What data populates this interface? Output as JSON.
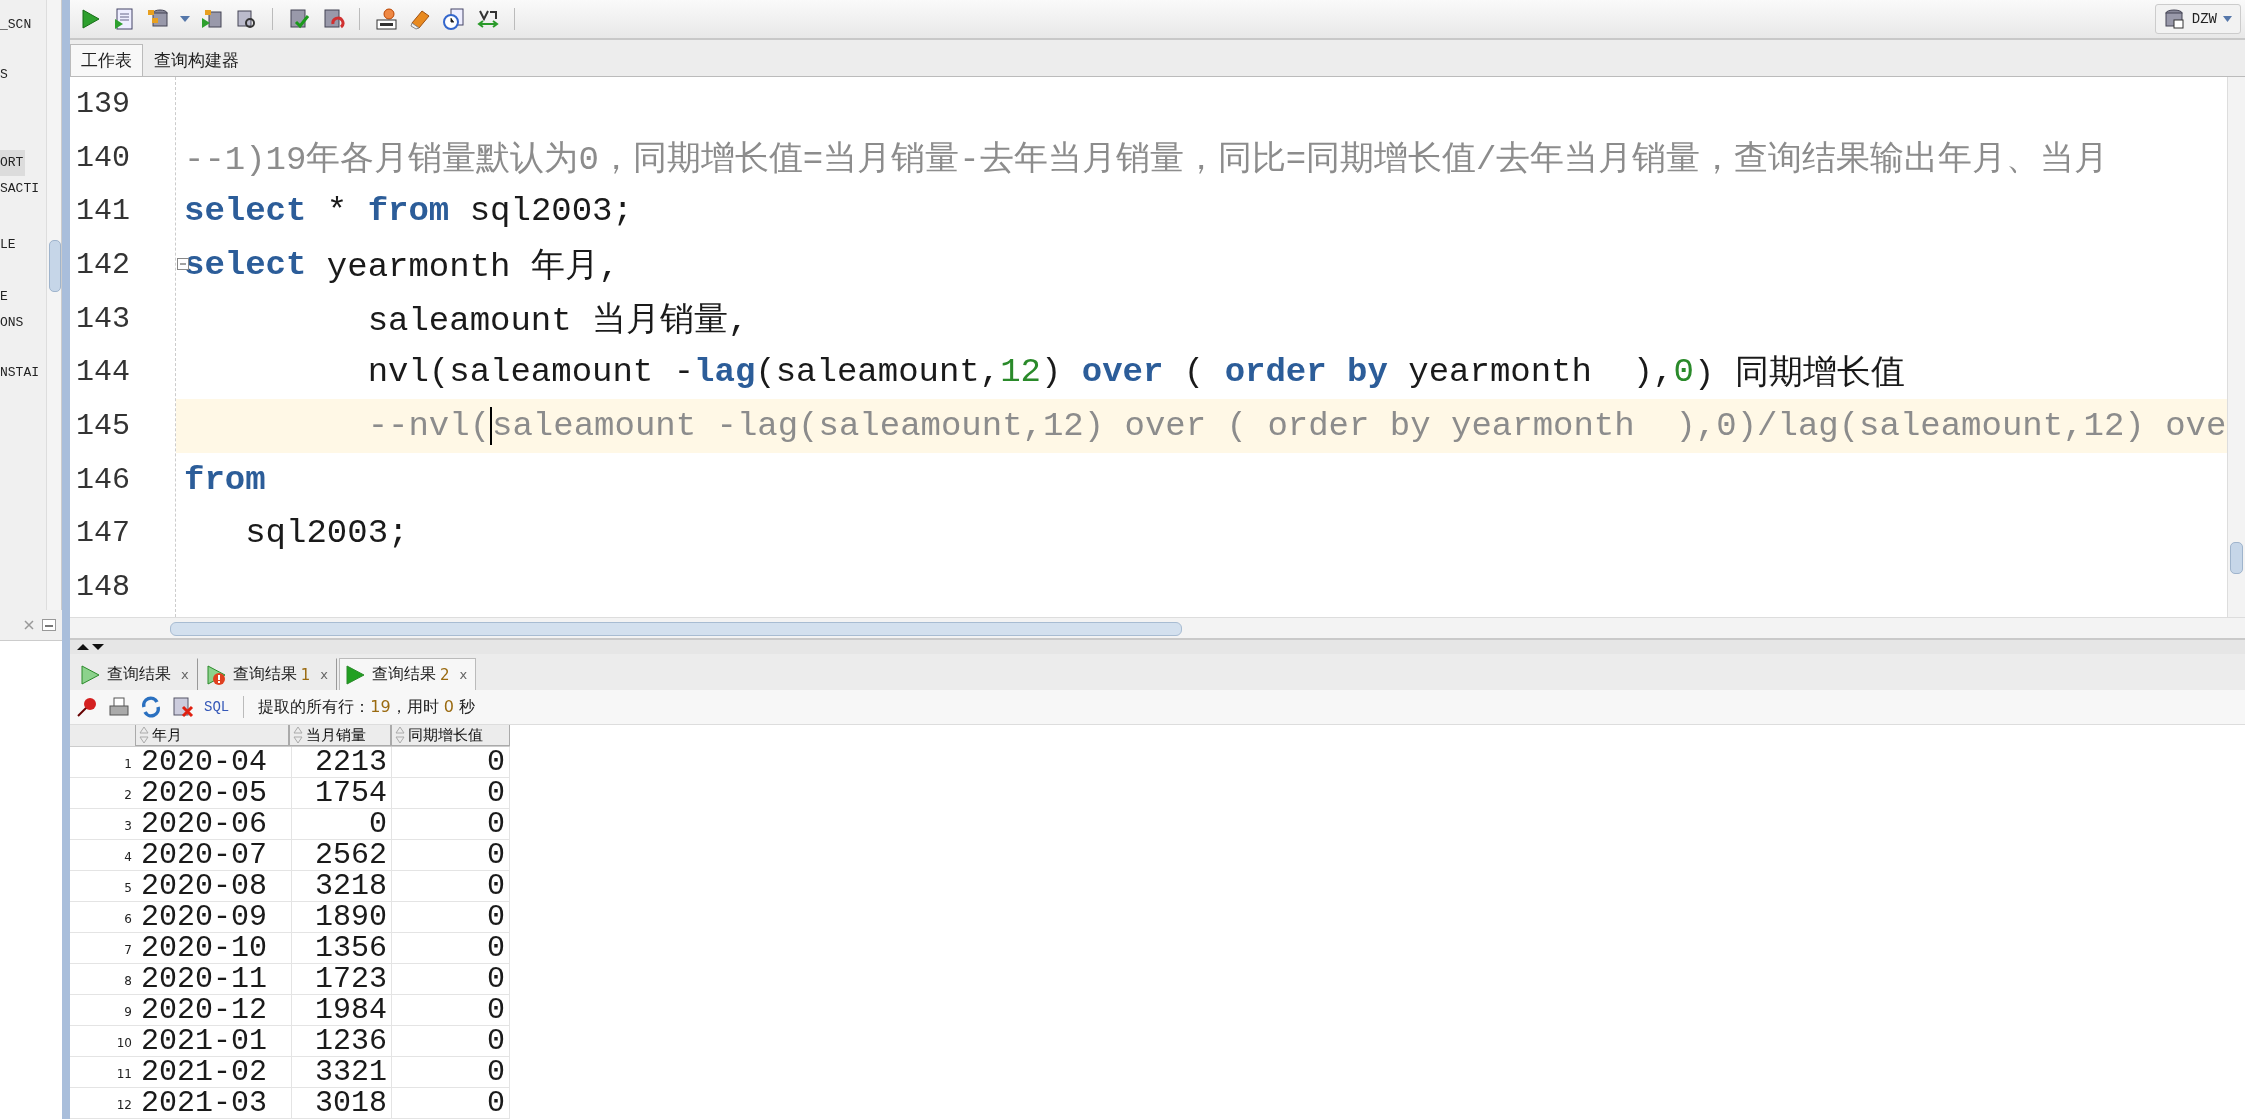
{
  "sidebar": {
    "items": [
      {
        "label": "_SCN",
        "selected": false
      },
      {
        "label": "S",
        "selected": false
      },
      {
        "label": "ORT",
        "selected": true
      },
      {
        "label": "SACTI",
        "selected": false
      },
      {
        "label": "LE",
        "selected": false
      },
      {
        "label": "E",
        "selected": false
      },
      {
        "label": "ONS",
        "selected": false
      },
      {
        "label": "NSTAI",
        "selected": false
      }
    ]
  },
  "connection": {
    "label": "DZW"
  },
  "editor_tabs": [
    {
      "label": "工作表",
      "selected": true
    },
    {
      "label": "查询构建器",
      "selected": false
    }
  ],
  "editor": {
    "lines": [
      {
        "number": "139",
        "current": false
      },
      {
        "number": "140",
        "current": false,
        "tokens": [
          {
            "kind": "comment",
            "text": "--1)19年各月销量默认为0，同期增长值=当月销量-去年当月销量，同比=同期增长值/去年当月销量，查询结果输出年月、当月"
          }
        ]
      },
      {
        "number": "141",
        "current": false,
        "tokens": [
          {
            "kind": "keyword",
            "text": "select"
          },
          {
            "kind": "plain",
            "text": " * "
          },
          {
            "kind": "keyword",
            "text": "from"
          },
          {
            "kind": "plain",
            "text": " sql2003;"
          }
        ]
      },
      {
        "number": "142",
        "current": false,
        "foldable": true,
        "tokens": [
          {
            "kind": "keyword",
            "text": "select"
          },
          {
            "kind": "plain",
            "text": " yearmonth 年月,"
          }
        ]
      },
      {
        "number": "143",
        "current": false,
        "tokens": [
          {
            "kind": "plain",
            "text": "         saleamount 当月销量,"
          }
        ]
      },
      {
        "number": "144",
        "current": false,
        "tokens": [
          {
            "kind": "plain",
            "text": "         nvl(saleamount -"
          },
          {
            "kind": "keyword",
            "text": "lag"
          },
          {
            "kind": "plain",
            "text": "(saleamount,"
          },
          {
            "kind": "number",
            "text": "12"
          },
          {
            "kind": "plain",
            "text": ") "
          },
          {
            "kind": "keyword",
            "text": "over"
          },
          {
            "kind": "plain",
            "text": " ( "
          },
          {
            "kind": "keyword",
            "text": "order by"
          },
          {
            "kind": "plain",
            "text": " yearmonth  ),"
          },
          {
            "kind": "number",
            "text": "0"
          },
          {
            "kind": "plain",
            "text": ") 同期增长值"
          }
        ]
      },
      {
        "number": "145",
        "current": true,
        "tokens": [
          {
            "kind": "comment",
            "text": "         --nvl("
          },
          {
            "kind": "caret"
          },
          {
            "kind": "comment",
            "text": "saleamount -lag(saleamount,12) over ( order by yearmonth  ),0)/lag(saleamount,12) ove"
          }
        ]
      },
      {
        "number": "146",
        "current": false,
        "tokens": [
          {
            "kind": "keyword",
            "text": "from"
          }
        ]
      },
      {
        "number": "147",
        "current": false,
        "tokens": [
          {
            "kind": "plain",
            "text": "   sql2003;"
          }
        ]
      },
      {
        "number": "148",
        "current": false
      }
    ]
  },
  "result_tabs": [
    {
      "label": "查询结果",
      "close": "x",
      "warning": false,
      "selected": false
    },
    {
      "label": "查询结果",
      "count": "1",
      "close": "x",
      "warning": true,
      "selected": false
    },
    {
      "label": "查询结果",
      "count": "2",
      "close": "x",
      "warning": false,
      "selected": true
    }
  ],
  "result_toolbar": {
    "sql_link": "SQL",
    "fetched_label": "提取的所有行：",
    "rows": "19",
    "time_label": "，用时",
    "time": "0",
    "time_unit": "秒"
  },
  "table": {
    "columns": [
      {
        "label": "年月",
        "kind": "text"
      },
      {
        "label": "当月销量",
        "kind": "number"
      },
      {
        "label": "同期增长值",
        "kind": "number"
      }
    ],
    "rows": [
      {
        "index": "1",
        "cells": [
          "2020-04",
          "2213",
          "0"
        ]
      },
      {
        "index": "2",
        "cells": [
          "2020-05",
          "1754",
          "0"
        ]
      },
      {
        "index": "3",
        "cells": [
          "2020-06",
          "0",
          "0"
        ]
      },
      {
        "index": "4",
        "cells": [
          "2020-07",
          "2562",
          "0"
        ]
      },
      {
        "index": "5",
        "cells": [
          "2020-08",
          "3218",
          "0"
        ]
      },
      {
        "index": "6",
        "cells": [
          "2020-09",
          "1890",
          "0"
        ]
      },
      {
        "index": "7",
        "cells": [
          "2020-10",
          "1356",
          "0"
        ]
      },
      {
        "index": "8",
        "cells": [
          "2020-11",
          "1723",
          "0"
        ]
      },
      {
        "index": "9",
        "cells": [
          "2020-12",
          "1984",
          "0"
        ]
      },
      {
        "index": "10",
        "cells": [
          "2021-01",
          "1236",
          "0"
        ]
      },
      {
        "index": "11",
        "cells": [
          "2021-02",
          "3321",
          "0"
        ]
      },
      {
        "index": "12",
        "cells": [
          "2021-03",
          "3018",
          "0"
        ]
      }
    ]
  }
}
